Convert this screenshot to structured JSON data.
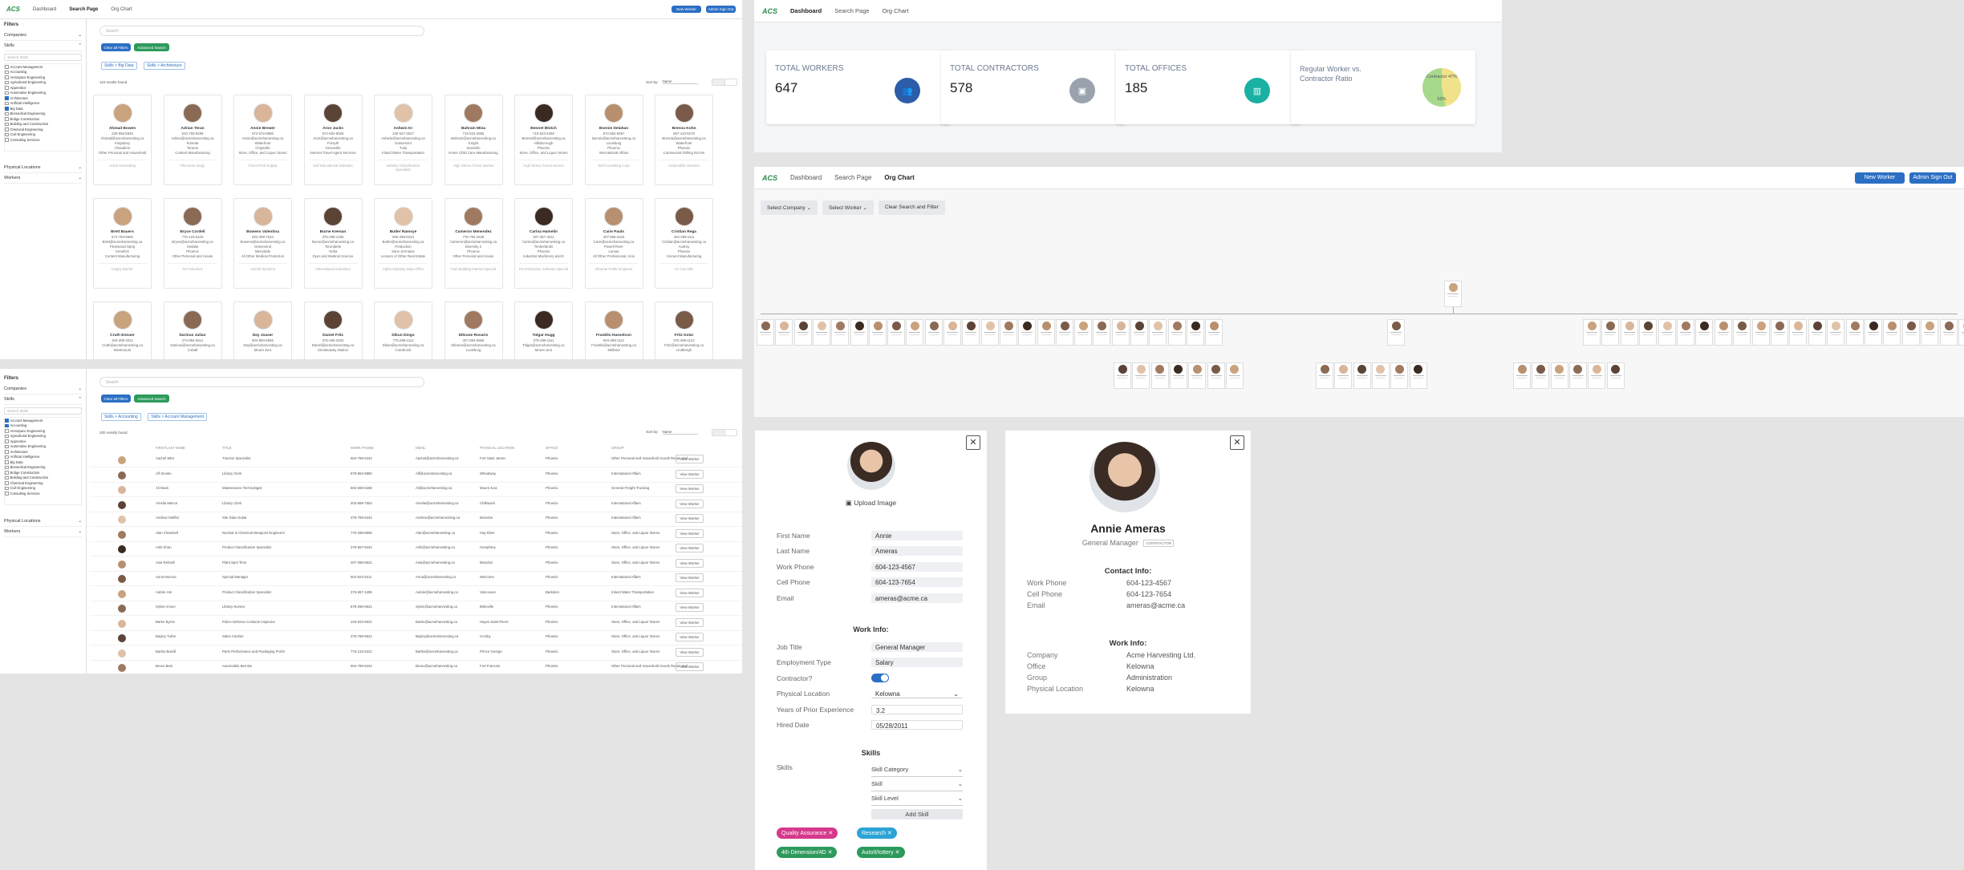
{
  "logo": "ACS",
  "nav": {
    "dashboard": "Dashboard",
    "search": "Search Page",
    "org": "Org Chart",
    "new_worker": "New Worker",
    "sign_out": "Admin Sign Out"
  },
  "filters": {
    "title": "Filters",
    "companies": "Companies",
    "skills": "Skills",
    "search_placeholder": "Search Skills",
    "physical": "Physical Locations",
    "workers": "Workers"
  },
  "skill_list": [
    "Account Management",
    "Accounting",
    "Aerospace Engineering",
    "Agricultural Engineering",
    "Apprentice",
    "Automotive Engineering",
    "Architecture",
    "Artificial Intelligence",
    "Big Data",
    "Biomedical Engineering",
    "Bridge Construction",
    "Building and Construction",
    "Chemical Engineering",
    "Civil Engineering",
    "Consulting Services"
  ],
  "search1": {
    "placeholder": "Search",
    "clear": "Clear all Filters",
    "advanced": "Advanced Search",
    "chips": [
      "Skills > Big Data",
      "Skills > Architecture"
    ],
    "count": "115 results found",
    "sort": "Sort by:",
    "sort_val": "Name"
  },
  "search2": {
    "chips": [
      "Skills > Accounting",
      "Skills > Account Management"
    ],
    "count": "200 results found"
  },
  "cards": [
    {
      "name": "Ahmad Bowen",
      "lines": [
        "230-956-5845",
        "Ahmad@acmeharvesting.ca",
        "Kingsbury",
        "Chaudiere",
        "Other Personal and Household"
      ],
      "company": "Acme Harvesting"
    },
    {
      "name": "Adrian Teran",
      "lines": [
        "510-783-9499",
        "Adrian@acmeharvesting.ca",
        "Rosetta",
        "Toronto",
        "Content Manufacturing"
      ],
      "company": "Phenome-ology"
    },
    {
      "name": "Annie Brewer",
      "lines": [
        "674-572-8866",
        "Annie@acmeharvesting.ca",
        "Waterfront",
        "Chipsville",
        "Store, Office, and Liquor Stores"
      ],
      "company": "Chem-Prod Supply"
    },
    {
      "name": "Aron Jacks",
      "lines": [
        "574-652-6825",
        "Aron@acmeharvesting.ca",
        "Forsyth",
        "Graceville",
        "Internet Travel Agent Services"
      ],
      "company": "Self Educational Institutes"
    },
    {
      "name": "Ashwin Kr",
      "lines": [
        "230-547-2547",
        "Ashwin@acmeharvesting.ca",
        "Grassmont",
        "Tulia",
        "Inland Water Transportation"
      ],
      "company": "Industry Classification Specialist"
    },
    {
      "name": "Bahram Mina",
      "lines": [
        "715-523-3655",
        "Bahram@acmeharvesting.ca",
        "Knight",
        "Sansville",
        "Home Child Care Manufacturing"
      ],
      "company": "High Stress Forest Nurses"
    },
    {
      "name": "Bennet Blotch",
      "lines": [
        "715-523-4460",
        "Bennet@acmeharvesting.ca",
        "Hillsborough",
        "Phoenix",
        "Store, Office, and Liquor Stores"
      ],
      "company": "High Stress Forest Nurses"
    },
    {
      "name": "Bonnie Delahan",
      "lines": [
        "574-652-6557",
        "Bonnie@acmeharvesting.ca",
        "Louisburg",
        "Phoenix",
        "International Affairs"
      ],
      "company": "Self Consulting Corp"
    },
    {
      "name": "Brenna Kohn",
      "lines": [
        "657-123-5278",
        "Brenna@acmeharvesting.ca",
        "Waterfront",
        "Phoenix",
        "Commercial Drilling Not Re"
      ],
      "company": "Automobile Vendors"
    },
    {
      "name": "Brett Bauers",
      "lines": [
        "674-783-9666",
        "Brett@acmeharvesting.ca",
        "Fleetwood Sprig",
        "Kenefick",
        "Content Manufacturing"
      ],
      "company": "Happy Barrier"
    },
    {
      "name": "Bryce Cordell",
      "lines": [
        "775-123-5423",
        "Bryce@acmeharvesting.ca",
        "Sedalia",
        "Phoenix",
        "Other Personal and House"
      ],
      "company": "Pet Solutions"
    },
    {
      "name": "Bowens Valentina",
      "lines": [
        "604-298-7534",
        "Bowens@acmeharvesting.ca",
        "Gravesend",
        "Merrydale",
        "All Other Medical Protection"
      ],
      "company": "Animal Systems"
    },
    {
      "name": "Burne Keenan",
      "lines": [
        "375-298-1255",
        "Burne@acmeharvesting.ca",
        "Torondette",
        "Yorka",
        "Dyes and Medical Science"
      ],
      "company": "International Industries"
    },
    {
      "name": "Butler Ramsye",
      "lines": [
        "605-298-5234",
        "Butler@acmeharvesting.ca",
        "Production",
        "Sans Jermaine",
        "Lessors of Other Real Estate"
      ],
      "company": "Alpha Highway Data Office"
    },
    {
      "name": "Cameron Menendez",
      "lines": [
        "775-784-2548",
        "Cameron@acmeharvesting.ca",
        "Diversity 2",
        "Phoenix",
        "Other Personal and House"
      ],
      "company": "Fuel Building Internet Special"
    },
    {
      "name": "Carina Hamelin",
      "lines": [
        "407-357-3211",
        "Carina@acmeharvesting.ca",
        "Timberlands",
        "Phoenix",
        "Industrial Machinery and E"
      ],
      "company": "Pre Enterprise Software Special"
    },
    {
      "name": "Carie Pauls",
      "lines": [
        "407-556-3434",
        "Carie@acmeharvesting.ca",
        "Powell River",
        "Larnax",
        "All Other Professional, Scie"
      ],
      "company": "Almonte Public Engineer"
    },
    {
      "name": "Cristian Rega",
      "lines": [
        "404-289-1111",
        "Cristian@acmeharvesting.ca",
        "Audrey",
        "Phoenix",
        "Cement Manufacturing"
      ],
      "company": "Air Gas Mile"
    },
    {
      "name": "Cruth Ennuer",
      "lines": [
        "404-298-3311",
        "Cruth@acmeharvesting.ca",
        "Westmount"
      ],
      "company": ""
    },
    {
      "name": "Darinus Julian",
      "lines": [
        "274-894-5511",
        "Darinus@acmeharvesting.ca",
        "Cobalt"
      ],
      "company": ""
    },
    {
      "name": "Day Joaser",
      "lines": [
        "604-894-5555",
        "Day@acmeharvesting.ca",
        "Mount Jura"
      ],
      "company": ""
    },
    {
      "name": "Daniel Fritz",
      "lines": [
        "375-265-3334",
        "Daniel@acmeharvesting.ca",
        "Smokeaway Station"
      ],
      "company": ""
    },
    {
      "name": "Dikun Dingo",
      "lines": [
        "775-298-1112",
        "Dikun@acmeharvesting.ca",
        "Cranbrook"
      ],
      "company": ""
    },
    {
      "name": "Dikrane Rosario",
      "lines": [
        "407-894-5565",
        "Dikrane@acmeharvesting.ca",
        "Louisburg"
      ],
      "company": ""
    },
    {
      "name": "Tolgar Hugg",
      "lines": [
        "375-298-1111",
        "Tolgar@acmeharvesting.ca",
        "Mount Jura"
      ],
      "company": ""
    },
    {
      "name": "Franklin Hasselcon",
      "lines": [
        "604-298-1112",
        "Franklin@acmeharvesting.ca",
        "Midland"
      ],
      "company": ""
    },
    {
      "name": "Fritz Kolar",
      "lines": [
        "375-298-1122",
        "Fritz@acmeharvesting.ca",
        "Lindbergh"
      ],
      "company": ""
    }
  ],
  "table": {
    "headers": [
      "FIRST/LAST NAME",
      "TITLE",
      "WORK PHONE",
      "EMAIL",
      "PHYSICAL LOCATION",
      "OFFICE",
      "GROUP"
    ],
    "view": "View Worker",
    "rows": [
      [
        "Aachel Wire",
        "Traction Specialist",
        "604-789-5234",
        "Aachel@acmeharvesting.ca",
        "Fort Saint James",
        "Phoenix",
        "Other Personal and Household Goods Repair and Maintenance"
      ],
      [
        "Alf Smoke",
        "Library Clerk",
        "878-952-8890",
        "Alf@acmeharvesting.ca",
        "Wheatway",
        "Phoenix",
        "International Affairs"
      ],
      [
        "Ali Mack",
        "Maintenance Technologist",
        "604-568-5258",
        "Ali@acmeharvesting.ca",
        "Mount Jura",
        "Phoenix",
        "General Freight Trucking"
      ],
      [
        "Amelia Mance",
        "Library Clerk",
        "403-568-7654",
        "Amelia@acmeharvesting.ca",
        "Chilliwack",
        "Phoenix",
        "International Affairs"
      ],
      [
        "Andrew Steffen",
        "Site Data Guitar",
        "375-789-5234",
        "Andrew@acmeharvesting.ca",
        "Brandon",
        "Phoenix",
        "International Affairs"
      ],
      [
        "Alan Chambell",
        "Nuclear & Chemical Weapons Engineering Officer",
        "775-298-8665",
        "Alan@acmeharvesting.ca",
        "Hay River",
        "Phoenix",
        "Store, Office, and Liquor Stores"
      ],
      [
        "Ashi Khan",
        "Product Classification Specialist",
        "375-567-5234",
        "Ashi@acmeharvesting.ca",
        "Humphrey",
        "Phoenix",
        "Store, Office, and Liquor Stores"
      ],
      [
        "Asia Rehash",
        "Plant Spot Time",
        "407-298-5521",
        "Asia@acmeharvesting.ca",
        "Brandon",
        "Phoenix",
        "Store, Office, and Liquor Stores"
      ],
      [
        "Anna Monroe",
        "Special Manager",
        "604-523-5211",
        "Anna@acmeharvesting.ca",
        "Welcome",
        "Phoenix",
        "International Affairs"
      ],
      [
        "Aubrie Hin",
        "Product Classification Specialist",
        "375-567-1295",
        "Aubrie@acmeharvesting.ca",
        "Vancouver",
        "Barkelen",
        "Inland Water Transportation"
      ],
      [
        "Sylvie Anson",
        "Library Nurses",
        "878-298-5521",
        "Sylvie@acmeharvesting.ca",
        "Brikeville",
        "Phoenix",
        "International Affairs"
      ],
      [
        "Barbe Byrne",
        "Police Defense Contacts Inspector",
        "226-523-5521",
        "Barbe@acmeharvesting.ca",
        "Hayes Saint Pierre",
        "Phoenix",
        "Store, Office, and Liquor Stores"
      ],
      [
        "Bayley Turbe",
        "Sales Cashier",
        "375-789-5521",
        "Bayley@acmeharvesting.ca",
        "Crosby",
        "Phoenix",
        "Store, Office, and Liquor Stores"
      ],
      [
        "Barbis Burnill",
        "Parts Performance and Packaging Professor",
        "776-123-5221",
        "Barbis@acmeharvesting.ca",
        "Prince George",
        "Phoenix",
        "Store, Office, and Liquor Stores"
      ],
      [
        "Bruno Bein",
        "Automobile Bernise",
        "604-789-5234",
        "Bruno@acmeharvesting.ca",
        "Fort Francois",
        "Phoenix",
        "Other Personal and Household Goods Repair and Maintenance"
      ]
    ]
  },
  "dashboard": {
    "stats": [
      {
        "label": "TOTAL WORKERS",
        "value": "647"
      },
      {
        "label": "TOTAL CONTRACTORS",
        "value": "578"
      },
      {
        "label": "TOTAL OFFICES",
        "value": "185"
      }
    ],
    "ratio_label": "Regular Worker vs. Contractor Ratio",
    "contractor_pct": "Contractor 47%",
    "regular_pct": "53%",
    "contractor_fraction": 0.47
  },
  "orgchart": {
    "select_company": "Select Company",
    "select_worker": "Select Worker",
    "clear": "Clear Search and Filter"
  },
  "edit": {
    "upload": "Upload Image",
    "fields": [
      [
        "First Name",
        "Annie"
      ],
      [
        "Last Name",
        "Ameras"
      ],
      [
        "Work Phone",
        "604-123-4567"
      ],
      [
        "Cell Phone",
        "604-123-7654"
      ],
      [
        "Email",
        "ameras@acme.ca"
      ]
    ],
    "work_title": "Work Info:",
    "job_title": "Job Title",
    "job_title_val": "General Manager",
    "emp_type": "Employment Type",
    "emp_type_val": "Salary",
    "contractor": "Contractor?",
    "phys": "Physical Location",
    "phys_val": "Kelowna",
    "years": "Years of Prior Experience",
    "years_val": "3.2",
    "hired": "Hired Date",
    "hired_val": "05/28/2011",
    "skills_title": "Skills",
    "skills_label": "Skills",
    "skill_cat": "Skill Category",
    "skill": "Skill",
    "skill_level": "Skill Level",
    "add": "Add Skill",
    "chips": [
      {
        "label": "Quality Assurance",
        "color": "#d6398b"
      },
      {
        "label": "Research",
        "color": "#2ba3d6"
      },
      {
        "label": "4th Dimension/4D",
        "color": "#2d9a5b"
      },
      {
        "label": "AutoIt/Iottery",
        "color": "#2d9a5b"
      }
    ]
  },
  "profile": {
    "name": "Annie Ameras",
    "title": "General Manager",
    "badge": "CONTRACTOR",
    "contact_title": "Contact Info:",
    "contact": [
      [
        "Work Phone",
        "604-123-4567"
      ],
      [
        "Cell Phone",
        "604-123-7654"
      ],
      [
        "Email",
        "ameras@acme.ca"
      ]
    ],
    "work_title": "Work Info:",
    "work": [
      [
        "Company",
        "Acme Harvesting Ltd."
      ],
      [
        "Office",
        "Kelowna"
      ],
      [
        "Group",
        "Administration"
      ],
      [
        "Physical Location",
        "Kelowna"
      ]
    ]
  }
}
